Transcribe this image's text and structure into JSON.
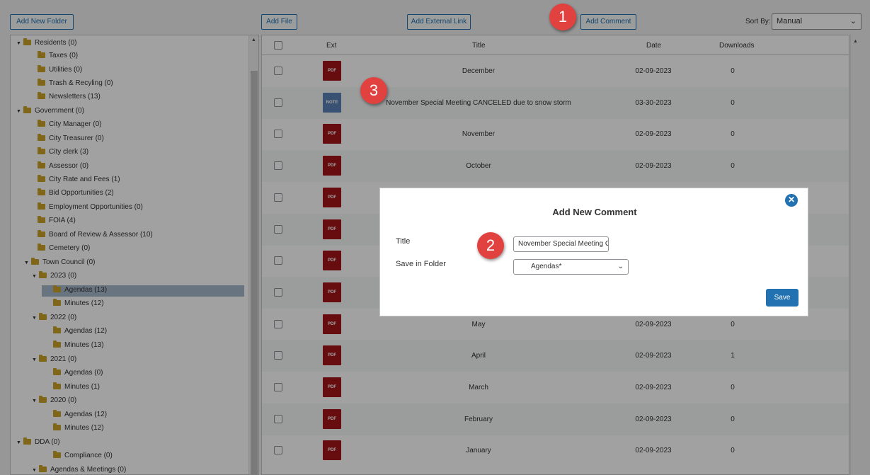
{
  "toolbar": {
    "add_folder": "Add New Folder",
    "add_file": "Add File",
    "add_link": "Add External Link",
    "add_comment": "Add Comment",
    "sort_label": "Sort By:",
    "sort_value": "Manual"
  },
  "tree": [
    {
      "label": "Residents (0)",
      "twisty": "▼"
    },
    {
      "label": "Taxes (0)",
      "twisty": ""
    },
    {
      "label": "Utilities (0)",
      "twisty": ""
    },
    {
      "label": "Trash & Recyling (0)",
      "twisty": ""
    },
    {
      "label": "Newsletters (13)",
      "twisty": ""
    },
    {
      "label": "Government (0)",
      "twisty": "▼"
    },
    {
      "label": "City Manager (0)",
      "twisty": ""
    },
    {
      "label": "City Treasurer (0)",
      "twisty": ""
    },
    {
      "label": "City clerk (3)",
      "twisty": ""
    },
    {
      "label": "Assessor (0)",
      "twisty": ""
    },
    {
      "label": "City Rate and Fees (1)",
      "twisty": ""
    },
    {
      "label": "Bid Opportunities (2)",
      "twisty": ""
    },
    {
      "label": "Employment Opportunities (0)",
      "twisty": ""
    },
    {
      "label": "FOIA (4)",
      "twisty": ""
    },
    {
      "label": "Board of Review & Assessor (10)",
      "twisty": ""
    },
    {
      "label": "Cemetery (0)",
      "twisty": ""
    },
    {
      "label": "Town Council (0)",
      "twisty": "▼"
    },
    {
      "label": "2023 (0)",
      "twisty": "▼"
    },
    {
      "label": "Agendas (13)",
      "twisty": ""
    },
    {
      "label": "Minutes (12)",
      "twisty": ""
    },
    {
      "label": "2022 (0)",
      "twisty": "▼"
    },
    {
      "label": "Agendas (12)",
      "twisty": ""
    },
    {
      "label": "Minutes (13)",
      "twisty": ""
    },
    {
      "label": "2021 (0)",
      "twisty": "▼"
    },
    {
      "label": "Agendas (0)",
      "twisty": ""
    },
    {
      "label": "Minutes (1)",
      "twisty": ""
    },
    {
      "label": "2020 (0)",
      "twisty": "▼"
    },
    {
      "label": "Agendas (12)",
      "twisty": ""
    },
    {
      "label": "Minutes (12)",
      "twisty": ""
    },
    {
      "label": "DDA (0)",
      "twisty": "▼"
    },
    {
      "label": "Compliance (0)",
      "twisty": ""
    },
    {
      "label": "Agendas & Meetings (0)",
      "twisty": "▼"
    }
  ],
  "table": {
    "headers": {
      "ext": "Ext",
      "title": "Title",
      "date": "Date",
      "downloads": "Downloads"
    },
    "rows": [
      {
        "ext": "PDF",
        "title": "December",
        "date": "02-09-2023",
        "downloads": "0"
      },
      {
        "ext": "NOTE",
        "title": "November Special Meeting CANCELED due to snow storm",
        "date": "03-30-2023",
        "downloads": "0"
      },
      {
        "ext": "PDF",
        "title": "November",
        "date": "02-09-2023",
        "downloads": "0"
      },
      {
        "ext": "PDF",
        "title": "October",
        "date": "02-09-2023",
        "downloads": "0"
      },
      {
        "ext": "PDF",
        "title": "",
        "date": "",
        "downloads": ""
      },
      {
        "ext": "PDF",
        "title": "",
        "date": "",
        "downloads": ""
      },
      {
        "ext": "PDF",
        "title": "",
        "date": "",
        "downloads": ""
      },
      {
        "ext": "PDF",
        "title": "",
        "date": "",
        "downloads": ""
      },
      {
        "ext": "PDF",
        "title": "May",
        "date": "02-09-2023",
        "downloads": "0"
      },
      {
        "ext": "PDF",
        "title": "April",
        "date": "02-09-2023",
        "downloads": "1"
      },
      {
        "ext": "PDF",
        "title": "March",
        "date": "02-09-2023",
        "downloads": "0"
      },
      {
        "ext": "PDF",
        "title": "February",
        "date": "02-09-2023",
        "downloads": "0"
      },
      {
        "ext": "PDF",
        "title": "January",
        "date": "02-09-2023",
        "downloads": "0"
      }
    ]
  },
  "modal": {
    "title": "Add New Comment",
    "close": "✕",
    "title_label": "Title",
    "title_value": "November Special Meeting CANCELED due to snow storm",
    "folder_label": "Save in Folder",
    "folder_value": "Agendas*",
    "save": "Save"
  },
  "callouts": [
    "1",
    "2",
    "3"
  ],
  "colors": {
    "accent": "#2271b1",
    "callout": "#e2423f",
    "pdf": "#a4161a",
    "note": "#5b80b5",
    "folder": "#c9a227"
  }
}
